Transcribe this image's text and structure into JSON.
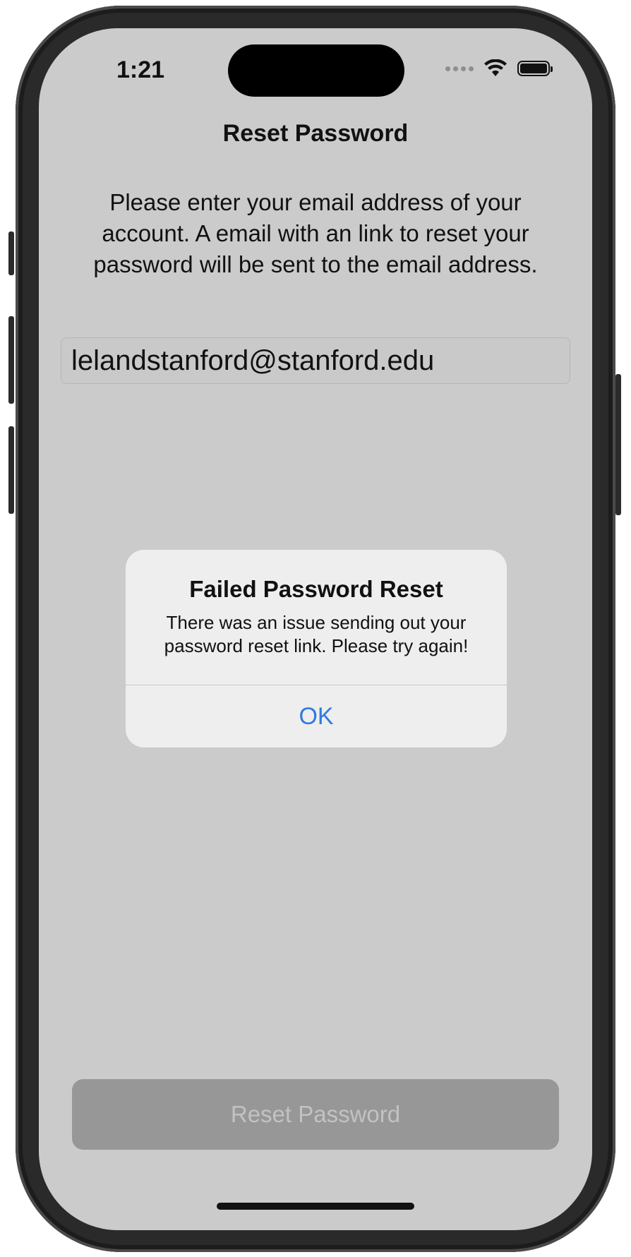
{
  "status_bar": {
    "time": "1:21",
    "icons": [
      "cellular-dots-icon",
      "wifi-icon",
      "battery-icon"
    ]
  },
  "nav": {
    "title": "Reset Password"
  },
  "form": {
    "instructions": "Please enter your email address of your account. A email with an link to reset your password will be sent to the email address.",
    "email_value": "lelandstanford@stanford.edu"
  },
  "alert": {
    "title": "Failed Password Reset",
    "message": "There was an issue sending out your password reset link. Please try again!",
    "ok_label": "OK",
    "ok_color": "#2F7BE0"
  },
  "footer": {
    "reset_button_label": "Reset Password"
  }
}
